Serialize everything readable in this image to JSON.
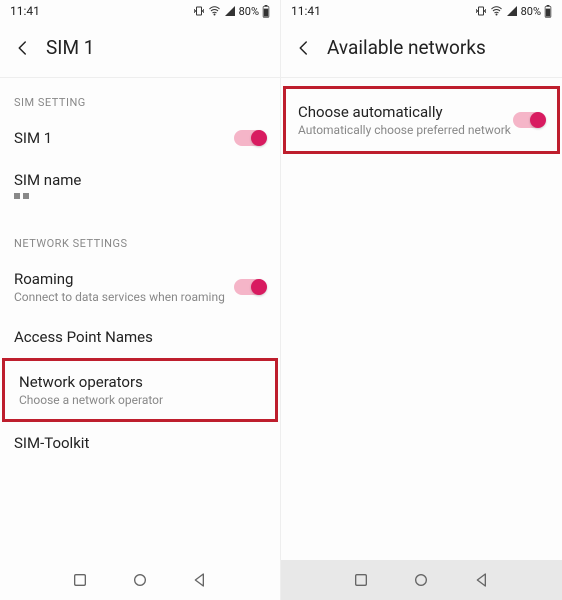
{
  "status": {
    "time": "11:41",
    "battery": "80%"
  },
  "left": {
    "title": "SIM 1",
    "sections": {
      "sim": "SIM SETTING",
      "network": "NETWORK SETTINGS"
    },
    "sim1": {
      "label": "SIM 1"
    },
    "simname": {
      "label": "SIM name"
    },
    "roaming": {
      "label": "Roaming",
      "sub": "Connect to data services when roaming"
    },
    "apn": {
      "label": "Access Point Names"
    },
    "netops": {
      "label": "Network operators",
      "sub": "Choose a network operator"
    },
    "simtoolkit": {
      "label": "SIM-Toolkit"
    }
  },
  "right": {
    "title": "Available networks",
    "chooseauto": {
      "label": "Choose automatically",
      "sub": "Automatically choose preferred network"
    }
  }
}
